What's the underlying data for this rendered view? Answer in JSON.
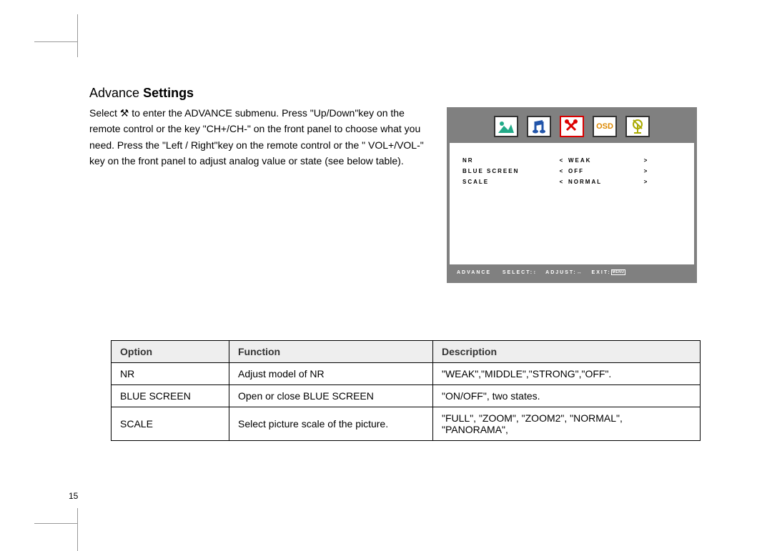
{
  "heading": {
    "part1": "Advance",
    "part2": " Settings"
  },
  "description": "Select ⚒ to enter the ADVANCE submenu. Press \"Up/Down\"key on the remote control or the key \"CH+/CH-\" on the front panel to choose what you need. Press the \"Left / Right\"key on the remote control or the \" VOL+/VOL-\" key on the front panel to adjust analog value or state (see below table).",
  "osd": {
    "rows": [
      {
        "label": "NR",
        "value": "WEAK"
      },
      {
        "label": "BLUE SCREEN",
        "value": "OFF"
      },
      {
        "label": "SCALE",
        "value": "NORMAL"
      }
    ],
    "footer": {
      "title": "ADVANCE",
      "select": "SELECT:",
      "adjust": "ADJUST:",
      "exit": "EXIT:",
      "menu": "MENU"
    }
  },
  "table": {
    "headers": [
      "Option",
      "Function",
      "Description"
    ],
    "rows": [
      {
        "option": "NR",
        "function": "Adjust model of NR",
        "description": "\"WEAK\",\"MIDDLE\",\"STRONG\",\"OFF\"."
      },
      {
        "option": "BLUE SCREEN",
        "function": "Open or close BLUE SCREEN",
        "description": "\"ON/OFF\", two states."
      },
      {
        "option": "SCALE",
        "function": "Select picture scale of the picture.",
        "description": "\"FULL\", \"ZOOM\", \"ZOOM2\", \"NORMAL\", \"PANORAMA\","
      }
    ]
  },
  "pageNumber": "15"
}
